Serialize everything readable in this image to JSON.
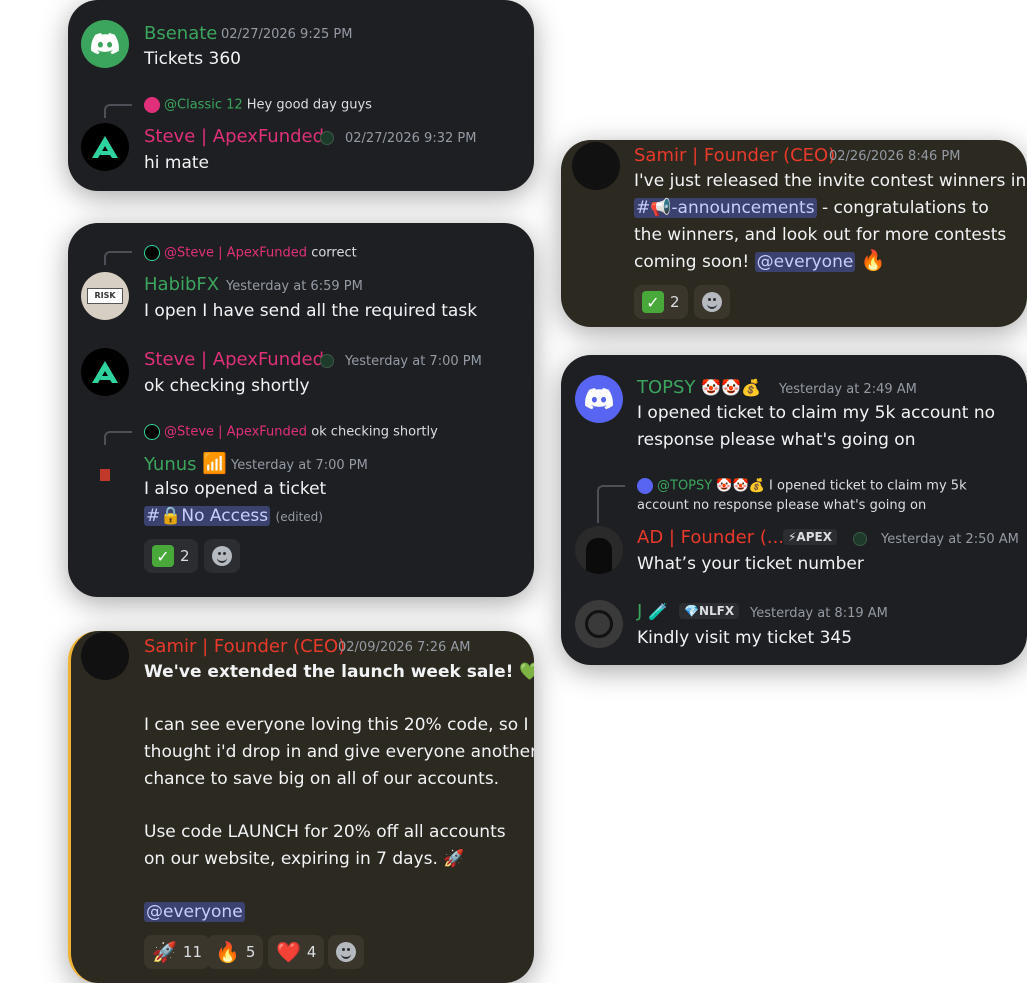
{
  "card1": {
    "msg1": {
      "author": "Bsenate",
      "timestamp": "02/27/2026 9:25 PM",
      "text": "Tickets 360"
    },
    "reply": {
      "mention": "@Classic 12",
      "text": "Hey good day guys"
    },
    "msg2": {
      "author": "Steve | ApexFunded",
      "timestamp": "02/27/2026 9:32 PM",
      "text": "hi mate"
    }
  },
  "card2": {
    "reply1": {
      "mention": "@Steve | ApexFunded",
      "text": "correct"
    },
    "msg1": {
      "author": "HabibFX",
      "timestamp": "Yesterday at 6:59 PM",
      "text": "I open I have send all the required task"
    },
    "msg2": {
      "author": "Steve | ApexFunded",
      "timestamp": "Yesterday at 7:00 PM",
      "text": "ok checking shortly"
    },
    "reply2": {
      "mention": "@Steve | ApexFunded",
      "text": "ok checking shortly"
    },
    "msg3": {
      "author": "Yunus",
      "author_emoji": "📶",
      "timestamp": "Yesterday at 7:00 PM",
      "text": "I also opened a ticket",
      "channel": "#🔒No Access",
      "edited": "(edited)"
    },
    "reactions": [
      {
        "emoji": "✅",
        "count": "2"
      }
    ]
  },
  "card3": {
    "author": "Samir | Founder (CEO)",
    "timestamp": "02/09/2026 7:26 AM",
    "headline": "We've extended the launch week sale! 💚",
    "para1_l1": "I can see everyone loving this 20% code, so I",
    "para1_l2": "thought i'd drop in and give everyone another",
    "para1_l3": "chance to save big on all of our accounts.",
    "para2_l1": "Use code LAUNCH for 20% off all accounts",
    "para2_l2": "on our website, expiring in 7 days. 🚀",
    "mention": "@everyone",
    "reactions": [
      {
        "emoji": "🚀",
        "count": "11"
      },
      {
        "emoji": "🔥",
        "count": "5"
      },
      {
        "emoji": "❤️",
        "count": "4"
      }
    ]
  },
  "card4": {
    "author": "Samir | Founder (CEO)",
    "timestamp": "02/26/2026 8:46 PM",
    "l1": "I've just released the invite contest winners in",
    "channel": "#📢-announcements",
    "l2_rest": " - congratulations to",
    "l3": "the winners, and look out for more contests",
    "l4": "coming soon!",
    "mention": "@everyone",
    "emoji": "🔥",
    "reactions": [
      {
        "emoji": "✅",
        "count": "2"
      }
    ]
  },
  "card5": {
    "msg1": {
      "author": "TOPSY",
      "author_emoji": "🤡🤡💰",
      "timestamp": "Yesterday at 2:49 AM",
      "l1": "I opened ticket to claim my 5k account no",
      "l2": "response please what's going on"
    },
    "reply": {
      "mention": "@TOPSY 🤡🤡💰",
      "l1": "I opened ticket to claim my 5k",
      "l2": "account no response please what's going on"
    },
    "msg2": {
      "author": "AD | Founder (...",
      "badge": "⚡APEX",
      "timestamp": "Yesterday at 2:50 AM",
      "text": "What’s your ticket number"
    },
    "msg3": {
      "author": "J",
      "author_emoji": "🧪",
      "badge": "💎NLFX",
      "timestamp": "Yesterday at 8:19 AM",
      "text": "Kindly visit my ticket 345"
    }
  },
  "colors": {
    "green": "#3ba55d",
    "pink": "#e0307a",
    "red": "#e8392b",
    "blurple": "#5865f2",
    "bg": "#1e1f22",
    "brown": "#2c2921"
  }
}
